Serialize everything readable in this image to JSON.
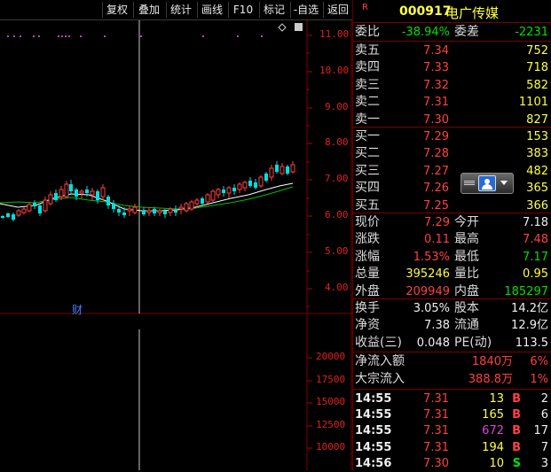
{
  "toolbar": {
    "buttons": [
      "复权",
      "叠加",
      "统计",
      "画线",
      "F10",
      "标记",
      "-自选",
      "返回"
    ]
  },
  "price_axis": [
    "11.00",
    "10.00",
    "9.00",
    "8.00",
    "7.00",
    "6.00",
    "5.00",
    "4.00"
  ],
  "volume_axis": [
    "20000",
    "17500",
    "15000",
    "12500",
    "10000"
  ],
  "marker_cai": "财",
  "stock": {
    "flag": "R",
    "code": "000917",
    "name": "电广传媒"
  },
  "wei": {
    "weibi_label": "委比",
    "weibi_value": "-38.94%",
    "weicha_label": "委差",
    "weicha_value": "-2231"
  },
  "asks": [
    {
      "label": "卖五",
      "price": "7.34",
      "vol": "752"
    },
    {
      "label": "卖四",
      "price": "7.33",
      "vol": "718"
    },
    {
      "label": "卖三",
      "price": "7.32",
      "vol": "582"
    },
    {
      "label": "卖二",
      "price": "7.31",
      "vol": "1101"
    },
    {
      "label": "卖一",
      "price": "7.30",
      "vol": "827"
    }
  ],
  "bids": [
    {
      "label": "买一",
      "price": "7.29",
      "vol": "153"
    },
    {
      "label": "买二",
      "price": "7.28",
      "vol": "383"
    },
    {
      "label": "买三",
      "price": "7.27",
      "vol": "482"
    },
    {
      "label": "买四",
      "price": "7.26",
      "vol": "365"
    },
    {
      "label": "买五",
      "price": "7.25",
      "vol": "366"
    }
  ],
  "quote": [
    {
      "l1": "现价",
      "v1": "7.29",
      "c1": "red",
      "l2": "今开",
      "v2": "7.18",
      "c2": "white"
    },
    {
      "l1": "涨跌",
      "v1": "0.11",
      "c1": "red",
      "l2": "最高",
      "v2": "7.48",
      "c2": "red"
    },
    {
      "l1": "涨幅",
      "v1": "1.53%",
      "c1": "red",
      "l2": "最低",
      "v2": "7.17",
      "c2": "green"
    },
    {
      "l1": "总量",
      "v1": "395246",
      "c1": "yellow",
      "l2": "量比",
      "v2": "0.95",
      "c2": "yellow"
    },
    {
      "l1": "外盘",
      "v1": "209949",
      "c1": "red",
      "l2": "内盘",
      "v2": "185297",
      "c2": "green"
    }
  ],
  "fundamentals": [
    {
      "l1": "换手",
      "v1": "3.05%",
      "l2": "股本",
      "v2": "14.2亿"
    },
    {
      "l1": "净资",
      "v1": "7.38",
      "l2": "流通",
      "v2": "12.9亿"
    },
    {
      "l1": "收益(三)",
      "v1": "0.048",
      "l2": "PE(动)",
      "v2": "113.5"
    }
  ],
  "flows": [
    {
      "label": "净流入额",
      "value": "1840万",
      "pct": "6%"
    },
    {
      "label": "大宗流入",
      "value": "388.8万",
      "pct": "1%"
    }
  ],
  "trades": [
    {
      "time": "14:55",
      "price": "7.31",
      "vol": "13",
      "vol_color": "yellow",
      "side": "B",
      "side_color": "red",
      "count": "2"
    },
    {
      "time": "14:55",
      "price": "7.31",
      "vol": "165",
      "vol_color": "yellow",
      "side": "B",
      "side_color": "red",
      "count": "6"
    },
    {
      "time": "14:55",
      "price": "7.31",
      "vol": "672",
      "vol_color": "magenta",
      "side": "B",
      "side_color": "red",
      "count": "17"
    },
    {
      "time": "14:55",
      "price": "7.31",
      "vol": "194",
      "vol_color": "yellow",
      "side": "B",
      "side_color": "red",
      "count": "7"
    },
    {
      "time": "14:56",
      "price": "7.30",
      "vol": "10",
      "vol_color": "yellow",
      "side": "S",
      "side_color": "green",
      "count": "3"
    }
  ],
  "colors": {
    "up": "#ff4040",
    "down": "#00e0e0",
    "ma_short": "#ffffff",
    "ma_long": "#00c000",
    "panel_border": "#7a0000"
  }
}
